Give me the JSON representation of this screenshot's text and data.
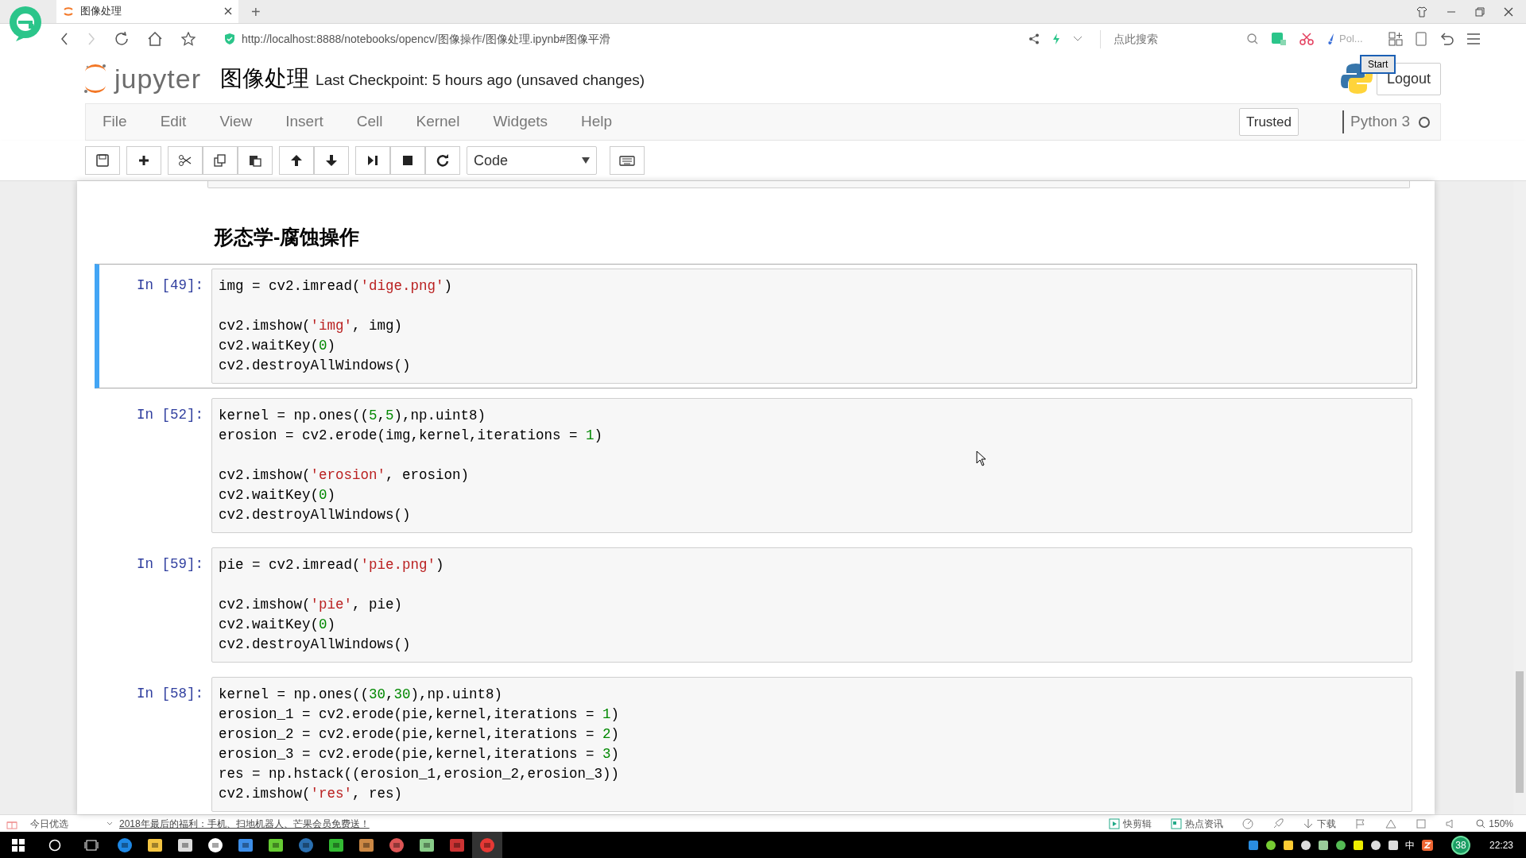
{
  "browser": {
    "tab_title": "图像处理",
    "new_tab": "+",
    "url": "http://localhost:8888/notebooks/opencv/图像操作/图像处理.ipynb#图像平滑",
    "search": {
      "placeholder": "点此搜索"
    },
    "extension_label": "Pol..."
  },
  "notebook": {
    "logo_text": "jupyter",
    "name": "图像处理",
    "checkpoint": "Last Checkpoint: 5 hours ago (unsaved changes)",
    "logout": "Logout",
    "recorder_button": "Start"
  },
  "menu": [
    "File",
    "Edit",
    "View",
    "Insert",
    "Cell",
    "Kernel",
    "Widgets",
    "Help"
  ],
  "toolbar": {
    "cell_type": "Code",
    "trusted": "Trusted",
    "kernel": "Python 3",
    "kernel_busy": false
  },
  "heading": "形态学-腐蚀操作",
  "cells": [
    {
      "prompt": "In [49]:",
      "selected": true,
      "blocks": [
        [
          "img = cv2.imread('dige.png')"
        ],
        [
          "cv2.imshow('img', img)",
          "cv2.waitKey(0)",
          "cv2.destroyAllWindows()"
        ]
      ]
    },
    {
      "prompt": "In [52]:",
      "selected": false,
      "blocks": [
        [
          "kernel = np.ones((5,5),np.uint8)",
          "erosion = cv2.erode(img,kernel,iterations = 1)"
        ],
        [
          "cv2.imshow('erosion', erosion)",
          "cv2.waitKey(0)",
          "cv2.destroyAllWindows()"
        ]
      ]
    },
    {
      "prompt": "In [59]:",
      "selected": false,
      "blocks": [
        [
          "pie = cv2.imread('pie.png')"
        ],
        [
          "cv2.imshow('pie', pie)",
          "cv2.waitKey(0)",
          "cv2.destroyAllWindows()"
        ]
      ]
    },
    {
      "prompt": "In [58]:",
      "selected": false,
      "blocks": [
        [
          "kernel = np.ones((30,30),np.uint8)",
          "erosion_1 = cv2.erode(pie,kernel,iterations = 1)",
          "erosion_2 = cv2.erode(pie,kernel,iterations = 2)",
          "erosion_3 = cv2.erode(pie,kernel,iterations = 3)",
          "res = np.hstack((erosion_1,erosion_2,erosion_3))",
          "cv2.imshow('res', res)"
        ]
      ]
    }
  ],
  "status_bar": {
    "left": "今日优选",
    "news": "2018年最后的福利：手机、扫地机器人、芒果会员免费送！",
    "right": [
      "快剪辑",
      "热点资讯",
      "下载"
    ],
    "zoom": "150%"
  },
  "taskbar": {
    "badge": "38",
    "ime": "中",
    "clock": "22:23"
  }
}
